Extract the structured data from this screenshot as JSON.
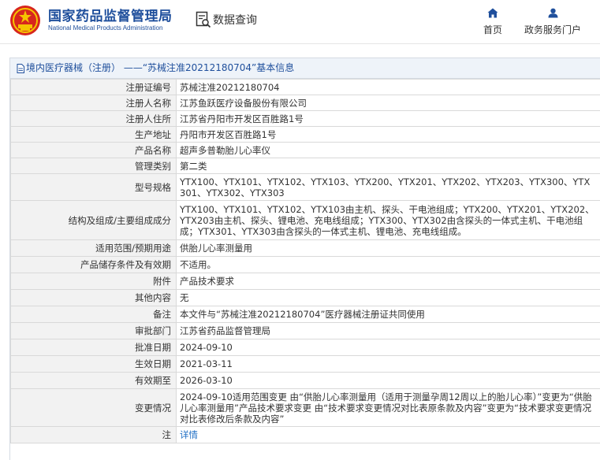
{
  "header": {
    "org_name_cn": "国家药品监督管理局",
    "org_name_en": "National Medical Products Administration",
    "query_label": "数据查询",
    "nav": [
      {
        "label": "首页",
        "icon": "home-icon"
      },
      {
        "label": "政务服务门户",
        "icon": "user-icon"
      }
    ]
  },
  "panel": {
    "title": "境内医疗器械（注册） ——“苏械注准20212180704”基本信息"
  },
  "rows": [
    {
      "label": "注册证编号",
      "value": "苏械注准20212180704"
    },
    {
      "label": "注册人名称",
      "value": "江苏鱼跃医疗设备股份有限公司"
    },
    {
      "label": "注册人住所",
      "value": "江苏省丹阳市开发区百胜路1号"
    },
    {
      "label": "生产地址",
      "value": "丹阳市开发区百胜路1号"
    },
    {
      "label": "产品名称",
      "value": "超声多普勒胎儿心率仪"
    },
    {
      "label": "管理类别",
      "value": "第二类"
    },
    {
      "label": "型号规格",
      "value": "YTX100、YTX101、YTX102、YTX103、YTX200、YTX201、YTX202、YTX203、YTX300、YTX301、YTX302、YTX303"
    },
    {
      "label": "结构及组成/主要组成成分",
      "value": "YTX100、YTX101、YTX102、YTX103由主机、探头、干电池组成；YTX200、YTX201、YTX202、YTX203由主机、探头、锂电池、充电线组成；YTX300、YTX302由含探头的一体式主机、干电池组成；YTX301、YTX303由含探头的一体式主机、锂电池、充电线组成。"
    },
    {
      "label": "适用范围/预期用途",
      "value": "供胎儿心率测量用"
    },
    {
      "label": "产品储存条件及有效期",
      "value": "不适用。"
    },
    {
      "label": "附件",
      "value": "产品技术要求"
    },
    {
      "label": "其他内容",
      "value": "无"
    },
    {
      "label": "备注",
      "value": "本文件与“苏械注准20212180704”医疗器械注册证共同使用"
    },
    {
      "label": "审批部门",
      "value": "江苏省药品监督管理局"
    },
    {
      "label": "批准日期",
      "value": "2024-09-10"
    },
    {
      "label": "生效日期",
      "value": "2021-03-11"
    },
    {
      "label": "有效期至",
      "value": "2026-03-10"
    },
    {
      "label": "变更情况",
      "value": "2024-09-10适用范围变更 由“供胎儿心率测量用（适用于测量孕周12周以上的胎儿心率）”变更为“供胎儿心率测量用”产品技术要求变更 由“技术要求变更情况对比表原条款及内容”变更为“技术要求变更情况对比表修改后条款及内容”"
    },
    {
      "label": "注",
      "value": "详情",
      "link": true
    }
  ]
}
